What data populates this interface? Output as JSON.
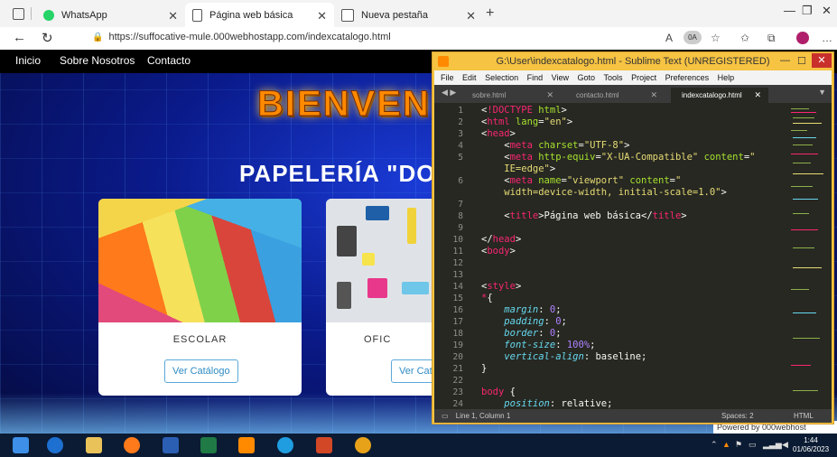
{
  "browser": {
    "tabs": [
      {
        "title": "WhatsApp",
        "icon": "whatsapp-icon"
      },
      {
        "title": "Página web básica",
        "icon": "page-icon"
      },
      {
        "title": "Nueva pestaña",
        "icon": "newtab-icon"
      }
    ],
    "url": "https://suffocative-mule.000webhostapp.com/indexcatalogo.html",
    "ext_badge": "0A"
  },
  "site": {
    "nav": [
      "Inicio",
      "Sobre Nosotros",
      "Contacto"
    ],
    "hero_title": "BIENVEN",
    "subtitle": "PAPELERÍA \"DO",
    "cards": [
      {
        "title": "ESCOLAR",
        "button": "Ver Catálogo"
      },
      {
        "title": "OFIC",
        "button": "Ver Cat"
      }
    ],
    "powered_by": "Powered by  000webhost"
  },
  "sublime": {
    "title": "G:\\User\\indexcatalogo.html - Sublime Text (UNREGISTERED)",
    "menu": [
      "File",
      "Edit",
      "Selection",
      "Find",
      "View",
      "Goto",
      "Tools",
      "Project",
      "Preferences",
      "Help"
    ],
    "tabs": [
      "sobre.html",
      "contacto.html",
      "indexcatalogo.html"
    ],
    "line_numbers": [
      "1",
      "2",
      "3",
      "4",
      "5",
      "",
      "6",
      "",
      "7",
      "8",
      "9",
      "10",
      "11",
      "12",
      "13",
      "14",
      "15",
      "16",
      "17",
      "18",
      "19",
      "20",
      "21",
      "22",
      "23",
      "24"
    ],
    "status_left": "Line 1, Column 1",
    "status_spaces": "Spaces: 2",
    "status_syntax": "HTML"
  },
  "taskbar": {
    "time": "1:44",
    "date": "01/06/2023"
  },
  "colors": {
    "sublime_frame": "#f6c342",
    "editor_bg": "#272822",
    "hero_orange": "#ff8a00",
    "page_blue": "#0a1a8a"
  }
}
